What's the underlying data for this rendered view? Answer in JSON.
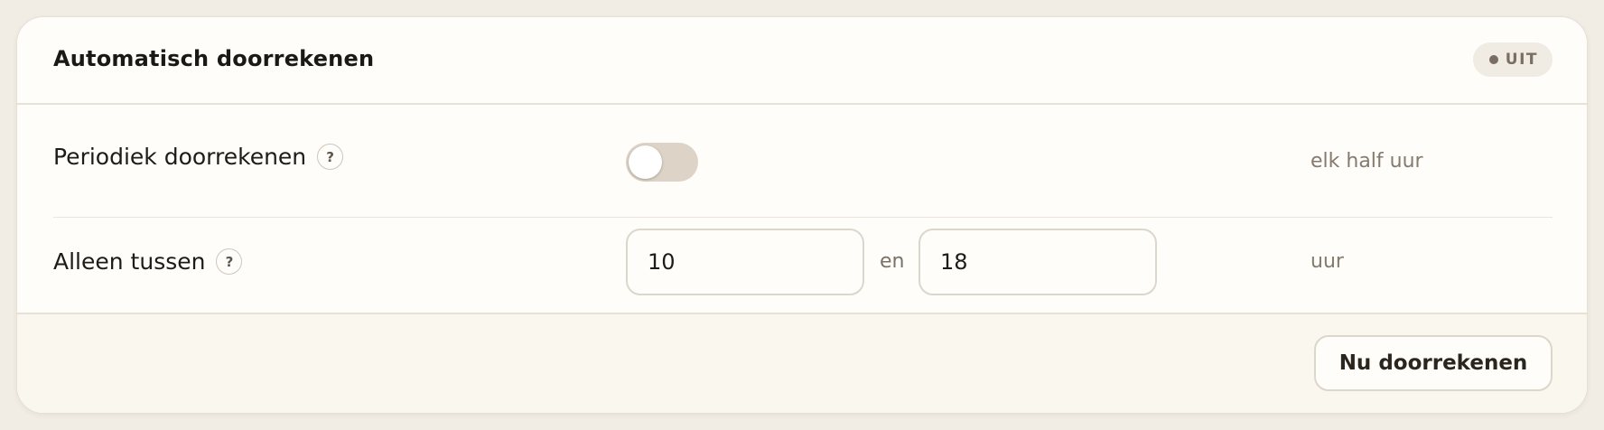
{
  "card": {
    "title": "Automatisch doorrekenen",
    "status": "UIT"
  },
  "periodic": {
    "label": "Periodiek doorrekenen",
    "help": "?",
    "toggle_on": false,
    "hint": "elk half uur"
  },
  "window": {
    "label": "Alleen tussen",
    "help": "?",
    "from_value": "10",
    "separator": "en",
    "to_value": "18",
    "unit": "uur"
  },
  "footer": {
    "action_label": "Nu doorrekenen"
  }
}
